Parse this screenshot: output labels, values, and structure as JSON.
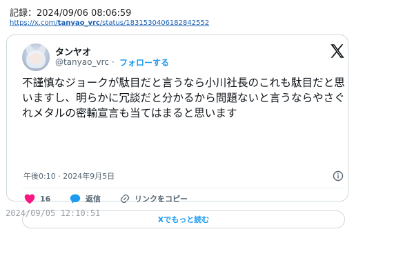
{
  "record": {
    "label": "記録：2024/09/06 08:06:59",
    "url_prefix": "https://x.com/",
    "url_user": "tanyao_vrc",
    "url_suffix": "/status/1831530406182842552"
  },
  "tweet": {
    "author_name": "タンヤオ",
    "handle": "@tanyao_vrc",
    "separator": "·",
    "follow_label": "フォローする",
    "text": "不謹慎なジョークが駄目だと言うなら小川社長のこれも駄目だと思いますし、明らかに冗談だと分かるから問題ないと言うならやさぐれメタルの密輸宣言も当てはまると思います",
    "timestamp": "午後0:10 · 2024年9月5日",
    "like_count": "16",
    "reply_label": "返信",
    "copy_link_label": "リンクをコピー",
    "read_more_label": "Xでもっと読む"
  },
  "footer": {
    "saved_time": "2024/09/05 12:10:51"
  },
  "icons": {
    "x_logo": "x-logo-icon",
    "info": "info-icon",
    "like": "heart-icon",
    "reply": "speech-bubble-icon",
    "copy_link": "link-icon"
  },
  "colors": {
    "link_blue": "#1d9bf0",
    "like_pink": "#f91880",
    "text": "#0f1419",
    "muted": "#536471",
    "border": "#cfd9de"
  }
}
